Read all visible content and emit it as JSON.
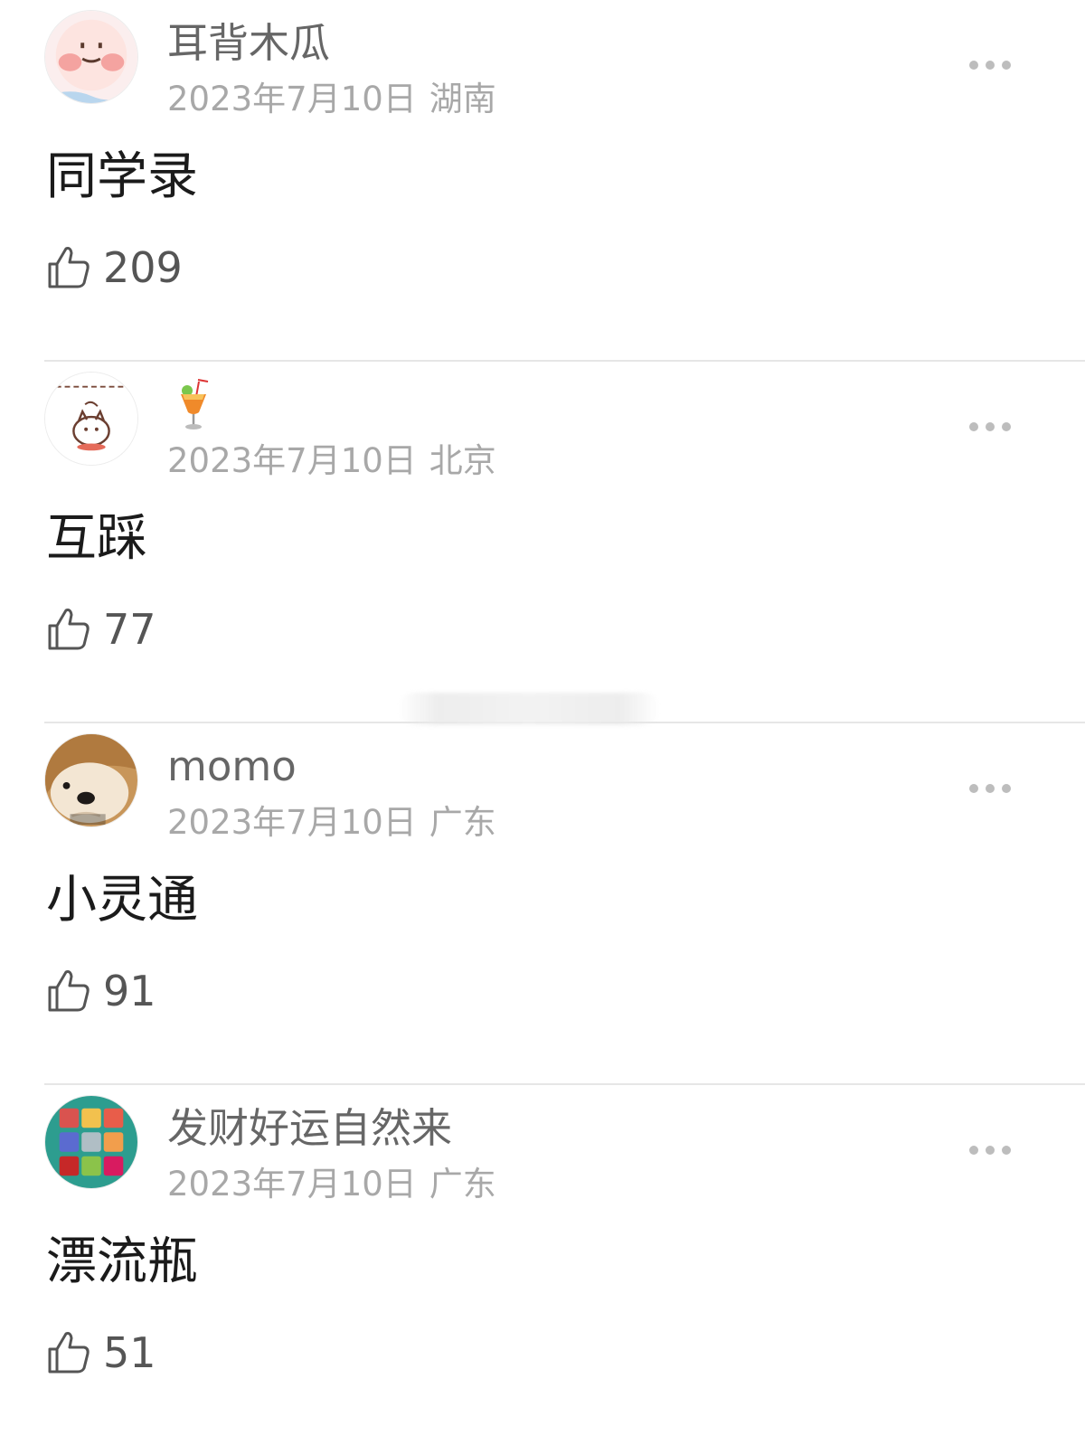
{
  "colors": {
    "username": "#666666",
    "meta": "#a8a8a8",
    "content": "#1b1b1b",
    "like_count": "#555555",
    "divider": "#e6e6e6"
  },
  "comments": [
    {
      "username": "耳背木瓜",
      "date": "2023年7月10日",
      "region": "湖南",
      "content": "同学录",
      "likes": "209",
      "avatar": "blush-face-avatar"
    },
    {
      "username": "",
      "username_icon": "tropical-drink-icon",
      "date": "2023年7月10日",
      "region": "北京",
      "content": "互踩",
      "likes": "77",
      "avatar": "doodle-cat-avatar"
    },
    {
      "username": "momo",
      "date": "2023年7月10日",
      "region": "广东",
      "content": "小灵通",
      "likes": "91",
      "avatar": "shiba-dog-avatar"
    },
    {
      "username": "发财好运自然来",
      "date": "2023年7月10日",
      "region": "广东",
      "content": "漂流瓶",
      "likes": "51",
      "avatar": "lucky-grid-avatar"
    }
  ]
}
